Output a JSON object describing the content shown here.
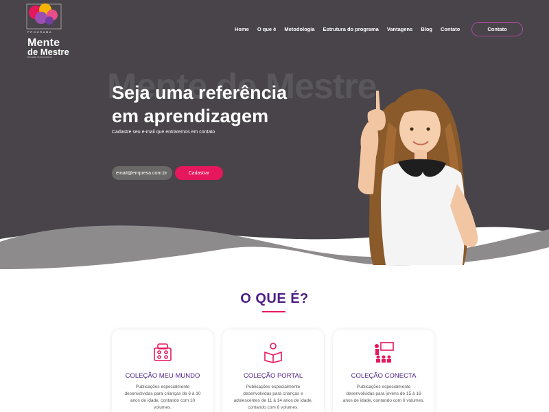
{
  "brand": {
    "tag": "PROGRAMA",
    "name_line1": "Mente",
    "name_line2": "de Mestre",
    "subtitle": "Educação Socioemocional"
  },
  "nav": {
    "items": [
      {
        "label": "Home"
      },
      {
        "label": "O que é"
      },
      {
        "label": "Metodologia"
      },
      {
        "label": "Estrutura do programa"
      },
      {
        "label": "Vantagens"
      },
      {
        "label": "Blog"
      },
      {
        "label": "Contato"
      }
    ],
    "contact_button": "Contato"
  },
  "hero": {
    "ghost_text": "Mente de Mestre",
    "headline": "Seja uma referência em aprendizagem",
    "subline": "Cadastre seu e-mail que entraremos em contato",
    "email_value": "email@empresa.com.br",
    "submit_label": "Cadastrar"
  },
  "section": {
    "title": "O QUE É?",
    "cards": [
      {
        "title": "COLEÇÃO MEU MUNDO",
        "icon": "blocks-icon",
        "description": "Publicações especialmente desenvolvidas para crianças de 6 à 10 anos de idade, contando com 10 volumes."
      },
      {
        "title": "COLEÇÃO PORTAL",
        "icon": "reader-icon",
        "description": "Publicações especialmente desenvolvidas para crianças e adolescentes de 11 à 14 anos de idade, contando com 8 volumes."
      },
      {
        "title": "COLEÇÃO CONECTA",
        "icon": "classroom-icon",
        "description": "Publicações especialmente desenvolvidas para jovens de 15 à 16 anos de idade, contando com 6 volumes."
      }
    ]
  },
  "colors": {
    "hero_bg": "#48444a",
    "wave_gray": "#8e8b8d",
    "accent_pink": "#e6175c",
    "title_purple": "#4b1f86",
    "button_border": "#b24a9e"
  }
}
